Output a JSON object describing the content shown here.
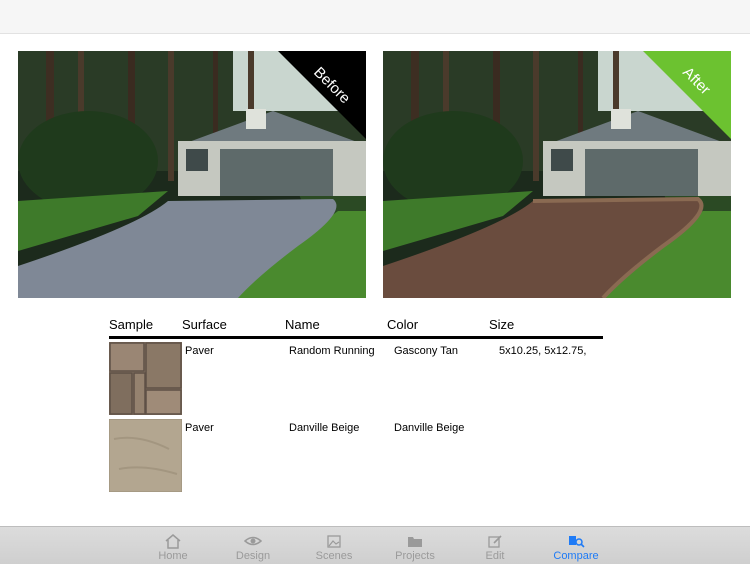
{
  "photos": {
    "before": {
      "ribbon": "Before",
      "ribbon_color": "#000000",
      "driveway_color": "#7f8896"
    },
    "after": {
      "ribbon": "After",
      "ribbon_color": "#6cc230",
      "driveway_color": "#6a4c3e"
    }
  },
  "table": {
    "headers": {
      "sample": "Sample",
      "surface": "Surface",
      "name": "Name",
      "color": "Color",
      "size": "Size"
    },
    "rows": [
      {
        "surface": "Paver",
        "name": "Random Running",
        "color": "Gascony Tan",
        "size": "5x10.25, 5x12.75,"
      },
      {
        "surface": "Paver",
        "name": "Danville Beige",
        "color": "Danville Beige",
        "size": ""
      }
    ]
  },
  "tabbar": {
    "active_color": "#1f7bf6",
    "tabs": [
      {
        "label": "Home",
        "icon": "home-icon"
      },
      {
        "label": "Design",
        "icon": "eye-icon"
      },
      {
        "label": "Scenes",
        "icon": "image-icon"
      },
      {
        "label": "Projects",
        "icon": "folder-icon"
      },
      {
        "label": "Edit",
        "icon": "edit-icon"
      },
      {
        "label": "Compare",
        "icon": "compare-icon",
        "active": true
      }
    ]
  }
}
